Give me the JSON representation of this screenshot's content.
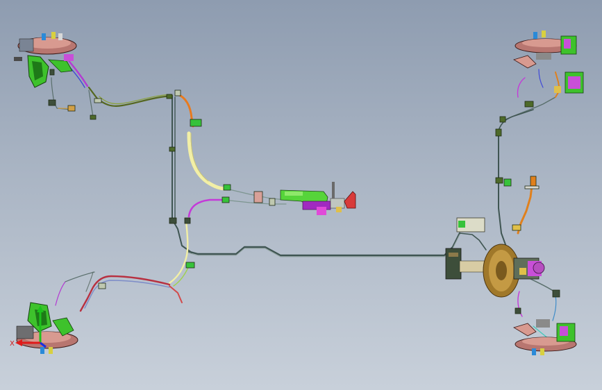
{
  "viewport": {
    "background_top": "#8e9cb0",
    "background_bottom": "#c8d0da"
  },
  "triad": {
    "x_label": "X",
    "x_color": "#e01a1a",
    "y_color": "#1cc21c",
    "z_color": "#1a2ee0"
  },
  "colors": {
    "brake_line": "#3f5552",
    "parking_cable_yellow": "#f2efa6",
    "hose_orange": "#e87a1e",
    "hose_magenta": "#c43ad8",
    "hose_red": "#b83040",
    "knuckle_green": "#3ec22c",
    "caliper_purple": "#c84fd8",
    "booster_brown": "#a0782a",
    "pedal_orange": "#e0801c",
    "handbrake_green": "#56d43a",
    "handbrake_red": "#d83a3a"
  },
  "icons": [
    "front-left-wheel-hub-icon",
    "rear-left-wheel-hub-icon",
    "front-right-wheel-hub-icon",
    "rear-right-wheel-hub-icon",
    "brake-booster-icon",
    "handbrake-lever-icon",
    "coordinate-triad-icon"
  ]
}
